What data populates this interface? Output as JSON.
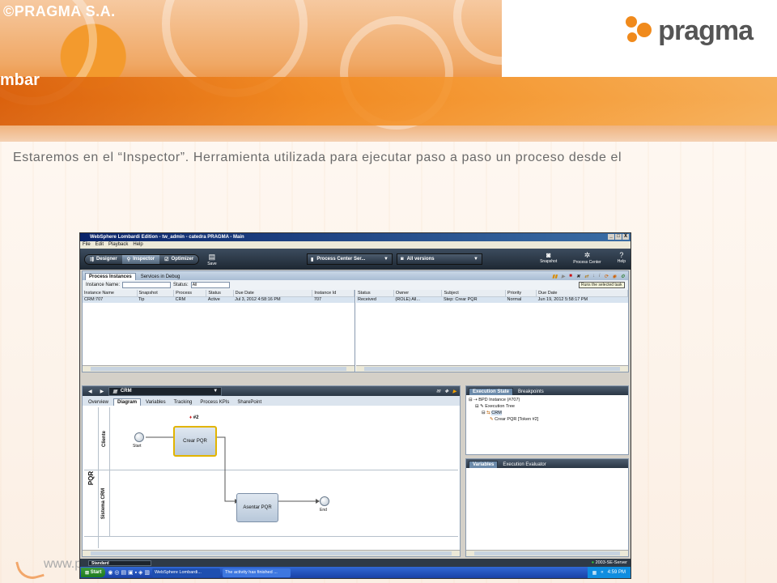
{
  "slide": {
    "copyright": "©PRAGMA S.A.",
    "section_title": "mbar",
    "logo_text": "pragma",
    "body_text": "Estaremos en el “Inspector”. Herramienta utilizada para ejecutar paso a paso un proceso desde el",
    "footer_url": "www.p",
    "colors": {
      "accent": "#f08a1c",
      "banner_dark": "#d95e0a"
    }
  },
  "window": {
    "title": "WebSphere Lombardi Edition - tw_admin - catedra PRAGMA - Main",
    "controls": [
      "_",
      "□",
      "X"
    ],
    "menu": [
      "File",
      "Edit",
      "Playback",
      "Help"
    ],
    "modes": [
      "Designer",
      "Inspector",
      "Optimizer"
    ],
    "save_label": "Save",
    "server_dropdown": "Process Center Ser...",
    "version_dropdown": "All versions",
    "right_buttons": [
      "Snapshot",
      "Process Center",
      "Help"
    ]
  },
  "instances_pane": {
    "tabs": [
      "Process Instances",
      "Services in Debug"
    ],
    "instance_name_label": "Instance Name:",
    "status_label": "Status:",
    "status_value": "All",
    "columns": [
      "Instance Name",
      "Snapshot",
      "Process",
      "Status",
      "Due Date",
      "Instance Id"
    ],
    "rows": [
      [
        "CRM:707",
        "Tip",
        "CRM",
        "Active",
        "Jul 3, 2012 4:58:16 PM",
        "707"
      ]
    ]
  },
  "tasks_pane": {
    "columns": [
      "Status",
      "Owner",
      "Subject",
      "Priority",
      "Due Date"
    ],
    "rows": [
      [
        "Received",
        "(ROLE) All...",
        "Step: Crear PQR",
        "Normal",
        "Jun 19, 2012 5:58:17 PM"
      ]
    ],
    "tooltip": "Runs the selected task"
  },
  "diagram_pane": {
    "process_name": "CRM",
    "tabs": [
      "Overview",
      "Diagram",
      "Variables",
      "Tracking",
      "Process KPIs",
      "SharePoint"
    ],
    "pool": "PQR",
    "lanes": [
      "Cliente",
      "Sistema CRM"
    ],
    "start_label": "Start",
    "end_label": "End",
    "activity1": "Crear PQR",
    "activity2": "Asentar PQR",
    "token_label": "#2"
  },
  "execution_pane": {
    "tabs": [
      "Execution State",
      "Breakpoints"
    ],
    "tree": [
      "BPD Instance (#707)",
      "Execution Tree",
      "CRM",
      "Crear PQR [Token #2]"
    ]
  },
  "variables_pane": {
    "tabs": [
      "Variables",
      "Execution Evaluator"
    ]
  },
  "statusbar": {
    "dropdown": "Standard",
    "server": "2003-SE-Server"
  },
  "taskbar": {
    "start": "Start",
    "tasks": [
      "WebSphere Lombardi...",
      "The activity has finished ..."
    ],
    "time": "4:59 PM"
  }
}
